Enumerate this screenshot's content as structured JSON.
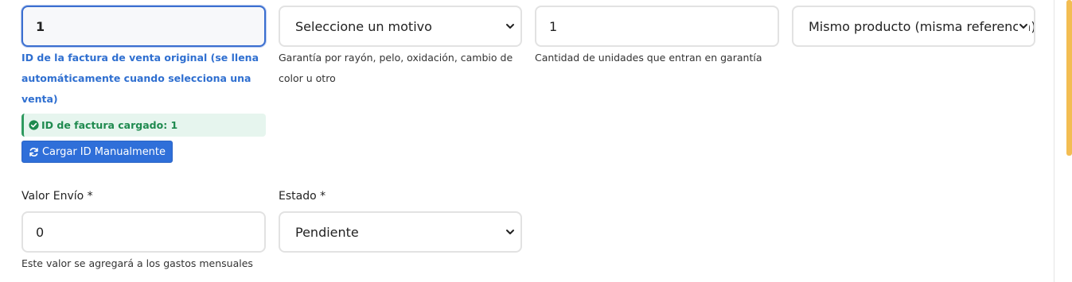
{
  "invoice_id": {
    "value": "1",
    "help": "ID de la factura de venta original (se llena automáticamente cuando selecciona una venta)",
    "loaded_badge": "ID de factura cargado: 1",
    "manual_button": "Cargar ID Manualmente"
  },
  "reason_select": {
    "selected": "Seleccione un motivo",
    "help": "Garantía por rayón, pelo, oxidación, cambio de color u otro"
  },
  "quantity": {
    "value": "1",
    "help": "Cantidad de unidades que entran en garantía"
  },
  "product_select": {
    "selected": "Mismo producto (misma referencia)"
  },
  "shipping": {
    "label": "Valor Envío *",
    "value": "0",
    "help": "Este valor se agregará a los gastos mensuales"
  },
  "status": {
    "label": "Estado *",
    "selected": "Pendiente"
  },
  "colors": {
    "accent_blue": "#2f6fd9",
    "success_green": "#1f8a4f",
    "warning_accent": "#f3bd52"
  }
}
